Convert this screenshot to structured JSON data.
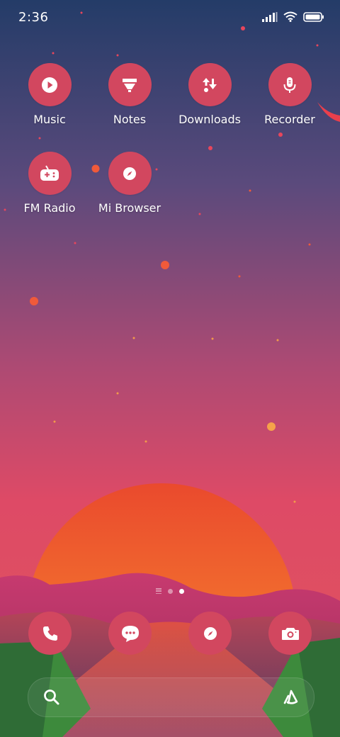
{
  "status_bar": {
    "time": "2:36",
    "icons": [
      "cellular-signal-icon",
      "wifi-icon",
      "battery-icon"
    ]
  },
  "apps": [
    {
      "label": "Music",
      "icon": "play-icon"
    },
    {
      "label": "Notes",
      "icon": "notes-icon"
    },
    {
      "label": "Downloads",
      "icon": "download-icon"
    },
    {
      "label": "Recorder",
      "icon": "microphone-icon"
    },
    {
      "label": "FM Radio",
      "icon": "radio-icon"
    },
    {
      "label": "Mi Browser",
      "icon": "compass-icon"
    }
  ],
  "page_indicator": {
    "pages": 2,
    "current": 2
  },
  "dock": [
    "phone-icon",
    "messages-icon",
    "compass-icon",
    "camera-icon"
  ],
  "search": {
    "icon": "search-icon",
    "assistant_icon": "assistant-icon"
  },
  "colors": {
    "icon_bg": "#d2475f",
    "sky_top": "#243c68",
    "sky_bottom": "#e24d66",
    "sun": "#f2722f"
  }
}
